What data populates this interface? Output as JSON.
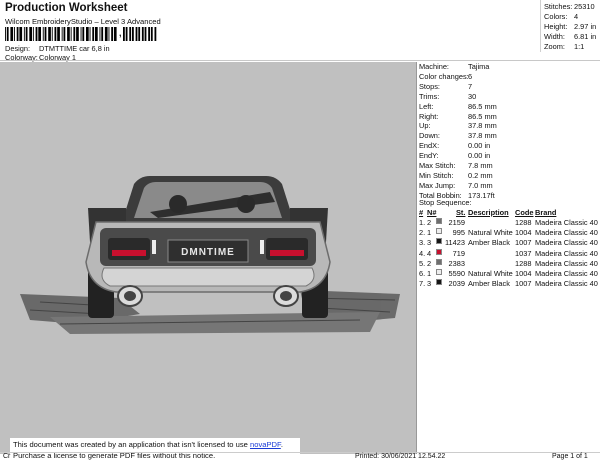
{
  "header": {
    "title": "Production Worksheet",
    "software": "Wilcom EmbroideryStudio – Level 3 Advanced",
    "barcode_suffix": ",",
    "design_label": "Design:",
    "design_value": "DTMTTIME car 6,8 in",
    "colorway_label": "Colorway:",
    "colorway_value": "Colorway 1"
  },
  "stats": [
    {
      "label": "Stitches:",
      "value": "25310"
    },
    {
      "label": "Colors:",
      "value": "4"
    },
    {
      "label": "Height:",
      "value": "2.97 in"
    },
    {
      "label": "Width:",
      "value": "6.81 in"
    },
    {
      "label": "Zoom:",
      "value": "1:1"
    }
  ],
  "properties": [
    {
      "label": "Machine:",
      "value": "Tajima"
    },
    {
      "label": "Color changes:",
      "value": "6"
    },
    {
      "label": "Stops:",
      "value": "7"
    },
    {
      "label": "Trims:",
      "value": "30"
    },
    {
      "label": "Left:",
      "value": "86.5 mm"
    },
    {
      "label": "Right:",
      "value": "86.5 mm"
    },
    {
      "label": "Up:",
      "value": "37.8 mm"
    },
    {
      "label": "Down:",
      "value": "37.8 mm"
    },
    {
      "label": "EndX:",
      "value": "0.00 in"
    },
    {
      "label": "EndY:",
      "value": "0.00 in"
    },
    {
      "label": "Max Stitch:",
      "value": "7.8 mm"
    },
    {
      "label": "Min Stitch:",
      "value": "0.2 mm"
    },
    {
      "label": "Max Jump:",
      "value": "7.0 mm"
    },
    {
      "label": "Total Bobbin:",
      "value": "173.17ft"
    }
  ],
  "stop_sequence": {
    "title": "Stop Sequence:",
    "headers": {
      "num": "#",
      "n": "N#",
      "st": "St.",
      "description": "Description",
      "code": "Code",
      "brand": "Brand"
    },
    "rows": [
      {
        "num": "1.",
        "n": "2",
        "color": "#6e6e6e",
        "st": "2159",
        "description": "",
        "code": "1288",
        "brand": "Madeira Classic 40"
      },
      {
        "num": "2.",
        "n": "1",
        "color": "#eeeeee",
        "st": "995",
        "description": "Natural White",
        "code": "1004",
        "brand": "Madeira Classic 40"
      },
      {
        "num": "3.",
        "n": "3",
        "color": "#151515",
        "st": "11423",
        "description": "Amber Black",
        "code": "1007",
        "brand": "Madeira Classic 40"
      },
      {
        "num": "4.",
        "n": "4",
        "color": "#c8102e",
        "st": "719",
        "description": "",
        "code": "1037",
        "brand": "Madeira Classic 40"
      },
      {
        "num": "5.",
        "n": "2",
        "color": "#6e6e6e",
        "st": "2383",
        "description": "",
        "code": "1288",
        "brand": "Madeira Classic 40"
      },
      {
        "num": "6.",
        "n": "1",
        "color": "#eeeeee",
        "st": "5590",
        "description": "Natural White",
        "code": "1004",
        "brand": "Madeira Classic 40"
      },
      {
        "num": "7.",
        "n": "3",
        "color": "#151515",
        "st": "2039",
        "description": "Amber Black",
        "code": "1007",
        "brand": "Madeira Classic 40"
      }
    ]
  },
  "design": {
    "plate_text": "DMNTIME"
  },
  "notice": {
    "line1_prefix": "This document was created by an application that isn't licensed to use ",
    "line1_link": "novaPDF",
    "line1_suffix": ".",
    "line2": "Purchase a license to generate PDF files without this notice."
  },
  "footer": {
    "left": "Cr",
    "printed": "Printed: 30/06/2021 12.54.22",
    "page": "Page 1 of 1"
  }
}
